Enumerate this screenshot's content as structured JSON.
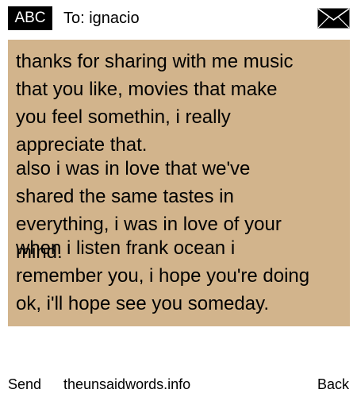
{
  "header": {
    "badge": "ABC",
    "to_line": "To: ignacio",
    "envelope_icon": "envelope-icon"
  },
  "note": {
    "background": "#d2b48c",
    "paragraphs": [
      "thanks for sharing with me music\nthat you like, movies that make\nyou feel somethin, i really\nappreciate that.",
      "also i was in love that we've\nshared the same tastes in\neverything, i was in love of your\nmind.",
      "when i listen frank ocean i\nremember you, i hope you're doing\nok, i'll hope see you someday."
    ]
  },
  "footer": {
    "send": "Send",
    "site": "theunsaidwords.info",
    "back": "Back"
  }
}
